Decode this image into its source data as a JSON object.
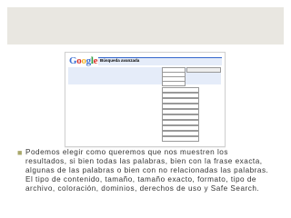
{
  "slide": {
    "body_text": "Podemos elegir como queremos que nos muestren los\nresultados, si bien todas las palabras, bien con la frase exacta,\nalgunas de las palabras o bien con no relacionadas las palabras.\nEl tipo de contenido, tamaño, tamaño exacto, formato, tipo de\narchivo, coloración, dominios, derechos de uso y Safe Search."
  },
  "screenshot": {
    "logo": "Google",
    "header_title": "Búsqueda avanzada"
  },
  "colors": {
    "band": "#e9e7e1",
    "bullet": "#a9a86b",
    "text": "#333333",
    "google_blue": "#3366cc",
    "form_bg": "#e5ecf9"
  }
}
